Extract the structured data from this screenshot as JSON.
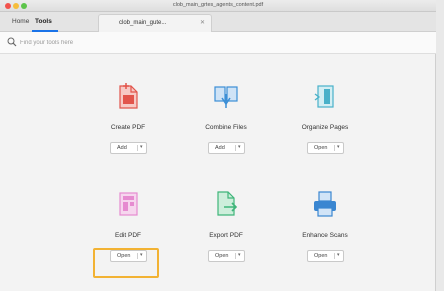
{
  "window": {
    "title": "clob_main_grtes_agents_content.pdf"
  },
  "nav": {
    "home": "Home",
    "tools": "Tools",
    "document_tab": "clob_main_gute..."
  },
  "search": {
    "placeholder": "Find your tools here"
  },
  "tools": [
    {
      "label": "Create PDF",
      "button": "Add",
      "icon": "create-pdf-icon",
      "color": "#e2544b"
    },
    {
      "label": "Combine Files",
      "button": "Add",
      "icon": "combine-files-icon",
      "color": "#3c8fd6"
    },
    {
      "label": "Organize Pages",
      "button": "Open",
      "icon": "organize-pages-icon",
      "color": "#49b1c9"
    },
    {
      "label": "Edit PDF",
      "button": "Open",
      "icon": "edit-pdf-icon",
      "color": "#e68bd0"
    },
    {
      "label": "Export PDF",
      "button": "Open",
      "icon": "export-pdf-icon",
      "color": "#3fb57a"
    },
    {
      "label": "Enhance Scans",
      "button": "Open",
      "icon": "enhance-scans-icon",
      "color": "#3a86d1"
    }
  ],
  "highlight": {
    "target": "edit-pdf-open-button",
    "color": "#f2b233"
  }
}
